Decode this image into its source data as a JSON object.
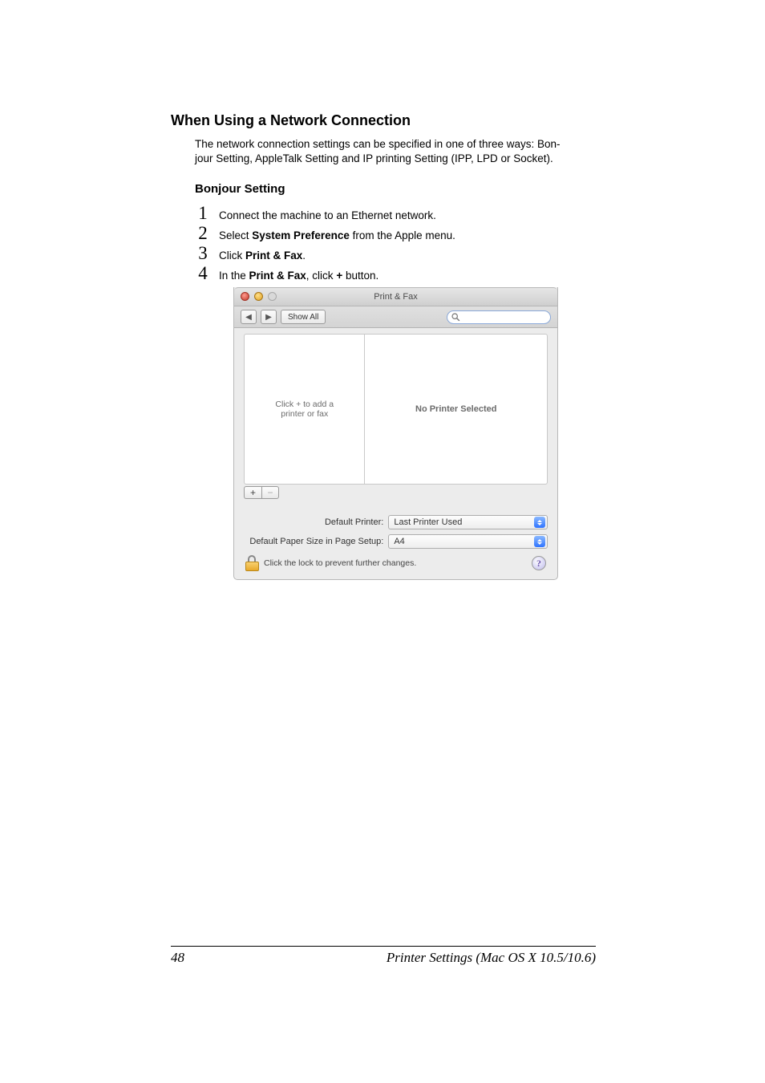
{
  "doc": {
    "heading": "When Using a Network Connection",
    "intro1": "The network connection settings can be specified in one of three ways: Bon-",
    "intro2": "jour Setting, AppleTalk Setting and IP printing Setting (IPP, LPD or Socket).",
    "subhead": "Bonjour Setting",
    "steps": [
      {
        "num": "1",
        "text": "Connect the machine to an Ethernet network."
      },
      {
        "num": "2",
        "pre": "Select ",
        "bold": "System Preference",
        "post": " from the Apple menu."
      },
      {
        "num": "3",
        "pre": "Click ",
        "bold": "Print & Fax",
        "post": "."
      },
      {
        "num": "4",
        "pre": "In the ",
        "bold": "Print & Fax",
        "mid": ", click ",
        "bold2": "+",
        "post": " button."
      }
    ]
  },
  "screenshot": {
    "title": "Print & Fax",
    "showall": "Show All",
    "nav_back": "◀",
    "nav_fwd": "▶",
    "left_hint1": "Click + to add a",
    "left_hint2": "printer or fax",
    "right_msg": "No Printer Selected",
    "add": "+",
    "remove": "−",
    "default_printer": {
      "label": "Default Printer:",
      "value": "Last Printer Used"
    },
    "default_paper": {
      "label": "Default Paper Size in Page Setup:",
      "value": "A4"
    },
    "lock_text": "Click the lock to prevent further changes.",
    "help": "?"
  },
  "footer": {
    "page": "48",
    "text": "Printer Settings (Mac OS X 10.5/10.6)"
  }
}
